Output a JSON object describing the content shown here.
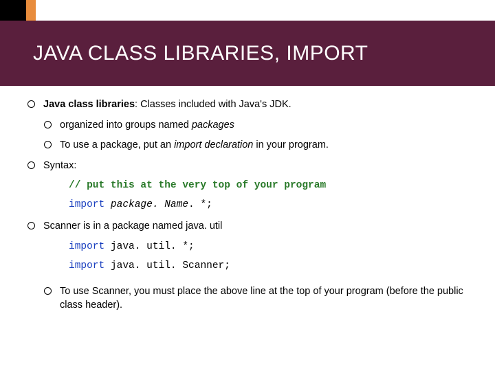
{
  "header": {
    "title": "JAVA CLASS LIBRARIES, IMPORT"
  },
  "body": {
    "b1_bold": "Java class libraries",
    "b1_rest": ": Classes included with Java's JDK.",
    "b1a_pre": "organized into groups named ",
    "b1a_italic": "packages",
    "b1b_pre": "To use a package, put an ",
    "b1b_italic": "import declaration",
    "b1b_post": " in your program.",
    "b2": "Syntax:",
    "code_comment": "// put this at the very top of your program",
    "code_import": "import ",
    "code_pkg": "package. Name",
    "code_star": ". *;",
    "b3": "Scanner is in a package named java. util",
    "code_util1_kw": "import ",
    "code_util1_rest": "java. util. *;",
    "code_util2_kw": "import ",
    "code_util2_pkg": "java. util. ",
    "code_util2_cls": "Scanner",
    "code_util2_end": ";",
    "b3a": "To use Scanner, you must place the above line at the top of your program (before the public class header)."
  }
}
